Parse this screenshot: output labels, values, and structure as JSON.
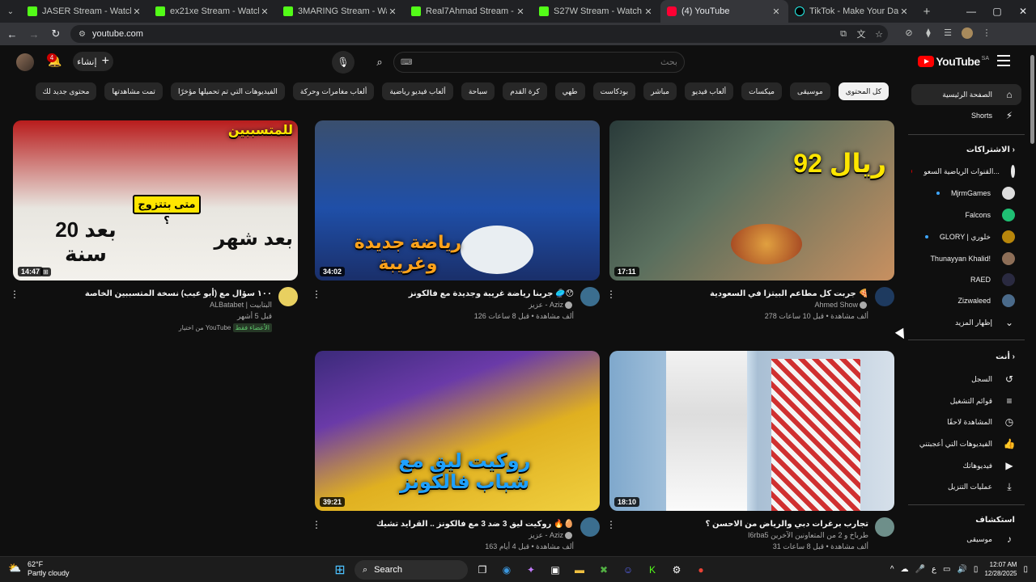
{
  "browser": {
    "tabs": [
      {
        "title": "JASER Stream - Watch Live on K",
        "favicon": "kick"
      },
      {
        "title": "ex21xe Stream - Watch Live on",
        "favicon": "kick"
      },
      {
        "title": "3MARING Stream - Watch Live",
        "favicon": "kick"
      },
      {
        "title": "Real7Ahmad Stream - Watch Li",
        "favicon": "kick"
      },
      {
        "title": "S27W Stream - Watch Live on K",
        "favicon": "kick"
      },
      {
        "title": "(4) YouTube",
        "favicon": "yt",
        "active": true
      },
      {
        "title": "TikTok - Make Your Day",
        "favicon": "tt"
      }
    ],
    "address": "youtube.com"
  },
  "header": {
    "logo_text": "YouTube",
    "logo_region": "SA",
    "search_placeholder": "بحث",
    "create_label": "إنشاء",
    "notification_count": "4"
  },
  "chips": [
    {
      "label": "كل المحتوى",
      "selected": true
    },
    {
      "label": "موسيقى"
    },
    {
      "label": "ميكسات"
    },
    {
      "label": "ألعاب فيديو"
    },
    {
      "label": "مباشر"
    },
    {
      "label": "بودكاست"
    },
    {
      "label": "طهي"
    },
    {
      "label": "كرة القدم"
    },
    {
      "label": "سباحة"
    },
    {
      "label": "ألعاب فيديو رياضية"
    },
    {
      "label": "ألعاب مغامرات وحركة"
    },
    {
      "label": "الفيديوهات التي تم تحميلها مؤخرًا"
    },
    {
      "label": "تمت مشاهدتها"
    },
    {
      "label": "محتوى جديد لك"
    }
  ],
  "videos": [
    {
      "title": "جربت كل مطاعم البيتزا في السعودية 🍕",
      "channel": "Ahmed Show",
      "views": "278 ألف مشاهدة",
      "age": "قبل 10 ساعات",
      "duration": "17:11",
      "overlay": "92 ريال"
    },
    {
      "title": "جربنا رياضة غريبة وجديدة مع فالكونز 🥏😯",
      "channel": "عزيز - Aziz",
      "views": "126 ألف مشاهدة",
      "age": "قبل 8 ساعات",
      "duration": "34:02",
      "overlay": "رياضة جديدة وغريبة"
    },
    {
      "title": "١٠٠ سؤال مع (أبو عيب) نسخة المتسببين الخاصة",
      "channel": "ALBatabet | البتابيت",
      "views": "قبل 5 أشهر",
      "age": "من اختيار YouTube",
      "badge": "الأعضاء فقط",
      "duration": "14:47",
      "overlay_top": "للمتسببين",
      "overlay_left": "بعد 20 سنة",
      "overlay_right": "بعد شهر",
      "overlay_center": "متى بتتزوج ؟"
    },
    {
      "title": "تجارب برغرات دبي والرياض من الاحسن ؟",
      "channel": "I6rba5 طرباخ و 2 من المتعاونين الآخرين",
      "views": "31 ألف مشاهدة",
      "age": "قبل 8 ساعات",
      "duration": "18:10"
    },
    {
      "title": "روكيت ليق 3 ضد 3 مع فالكونز .. القرايد تشيك 🔥🥚",
      "channel": "عزيز - Aziz",
      "views": "163 ألف مشاهدة",
      "age": "قبل 4 أيام",
      "duration": "39:21",
      "overlay": "روكيت ليق مع شباب فالكونز"
    }
  ],
  "sidebar": {
    "home": "الصفحة الرئيسية",
    "shorts": "Shorts",
    "subscriptions_head": "الاشتراكات",
    "subs": [
      {
        "name": "القنوات الرياضية السعو..."
      },
      {
        "name": "MjrmGames"
      },
      {
        "name": "Falcons"
      },
      {
        "name": "GLORY | خلوري"
      },
      {
        "name": "Thunayyan Khalid!"
      },
      {
        "name": "RAED"
      },
      {
        "name": "Zizwaleed"
      }
    ],
    "show_more": "إظهار المزيد",
    "you_head": "أنت",
    "you_items": [
      {
        "label": "السجل"
      },
      {
        "label": "قوائم التشغيل"
      },
      {
        "label": "المشاهدة لاحقًا"
      },
      {
        "label": "الفيديوهات التي أعجبتني"
      },
      {
        "label": "فيديوهاتك"
      },
      {
        "label": "عمليات التنزيل"
      }
    ],
    "explore_head": "استكشاف",
    "explore_items": [
      {
        "label": "موسيقى"
      }
    ]
  },
  "taskbar": {
    "temp": "62°F",
    "weather": "Partly cloudy",
    "search": "Search",
    "time": "12:07 AM",
    "date": "12/28/2025"
  }
}
